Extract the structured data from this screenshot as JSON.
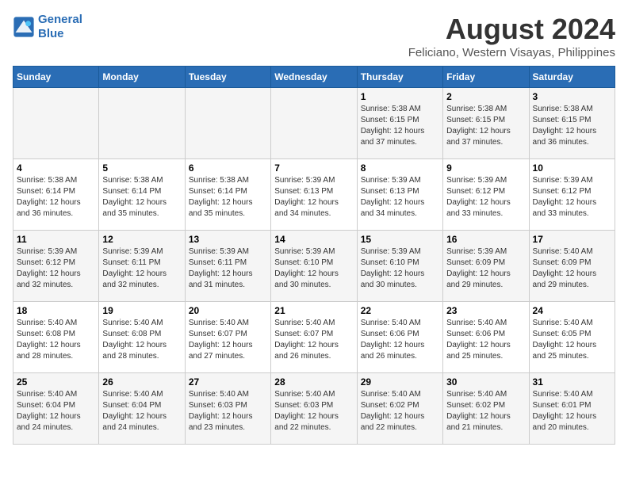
{
  "header": {
    "logo_line1": "General",
    "logo_line2": "Blue",
    "main_title": "August 2024",
    "subtitle": "Feliciano, Western Visayas, Philippines"
  },
  "weekdays": [
    "Sunday",
    "Monday",
    "Tuesday",
    "Wednesday",
    "Thursday",
    "Friday",
    "Saturday"
  ],
  "weeks": [
    [
      {
        "day": "",
        "info": ""
      },
      {
        "day": "",
        "info": ""
      },
      {
        "day": "",
        "info": ""
      },
      {
        "day": "",
        "info": ""
      },
      {
        "day": "1",
        "info": "Sunrise: 5:38 AM\nSunset: 6:15 PM\nDaylight: 12 hours\nand 37 minutes."
      },
      {
        "day": "2",
        "info": "Sunrise: 5:38 AM\nSunset: 6:15 PM\nDaylight: 12 hours\nand 37 minutes."
      },
      {
        "day": "3",
        "info": "Sunrise: 5:38 AM\nSunset: 6:15 PM\nDaylight: 12 hours\nand 36 minutes."
      }
    ],
    [
      {
        "day": "4",
        "info": "Sunrise: 5:38 AM\nSunset: 6:14 PM\nDaylight: 12 hours\nand 36 minutes."
      },
      {
        "day": "5",
        "info": "Sunrise: 5:38 AM\nSunset: 6:14 PM\nDaylight: 12 hours\nand 35 minutes."
      },
      {
        "day": "6",
        "info": "Sunrise: 5:38 AM\nSunset: 6:14 PM\nDaylight: 12 hours\nand 35 minutes."
      },
      {
        "day": "7",
        "info": "Sunrise: 5:39 AM\nSunset: 6:13 PM\nDaylight: 12 hours\nand 34 minutes."
      },
      {
        "day": "8",
        "info": "Sunrise: 5:39 AM\nSunset: 6:13 PM\nDaylight: 12 hours\nand 34 minutes."
      },
      {
        "day": "9",
        "info": "Sunrise: 5:39 AM\nSunset: 6:12 PM\nDaylight: 12 hours\nand 33 minutes."
      },
      {
        "day": "10",
        "info": "Sunrise: 5:39 AM\nSunset: 6:12 PM\nDaylight: 12 hours\nand 33 minutes."
      }
    ],
    [
      {
        "day": "11",
        "info": "Sunrise: 5:39 AM\nSunset: 6:12 PM\nDaylight: 12 hours\nand 32 minutes."
      },
      {
        "day": "12",
        "info": "Sunrise: 5:39 AM\nSunset: 6:11 PM\nDaylight: 12 hours\nand 32 minutes."
      },
      {
        "day": "13",
        "info": "Sunrise: 5:39 AM\nSunset: 6:11 PM\nDaylight: 12 hours\nand 31 minutes."
      },
      {
        "day": "14",
        "info": "Sunrise: 5:39 AM\nSunset: 6:10 PM\nDaylight: 12 hours\nand 30 minutes."
      },
      {
        "day": "15",
        "info": "Sunrise: 5:39 AM\nSunset: 6:10 PM\nDaylight: 12 hours\nand 30 minutes."
      },
      {
        "day": "16",
        "info": "Sunrise: 5:39 AM\nSunset: 6:09 PM\nDaylight: 12 hours\nand 29 minutes."
      },
      {
        "day": "17",
        "info": "Sunrise: 5:40 AM\nSunset: 6:09 PM\nDaylight: 12 hours\nand 29 minutes."
      }
    ],
    [
      {
        "day": "18",
        "info": "Sunrise: 5:40 AM\nSunset: 6:08 PM\nDaylight: 12 hours\nand 28 minutes."
      },
      {
        "day": "19",
        "info": "Sunrise: 5:40 AM\nSunset: 6:08 PM\nDaylight: 12 hours\nand 28 minutes."
      },
      {
        "day": "20",
        "info": "Sunrise: 5:40 AM\nSunset: 6:07 PM\nDaylight: 12 hours\nand 27 minutes."
      },
      {
        "day": "21",
        "info": "Sunrise: 5:40 AM\nSunset: 6:07 PM\nDaylight: 12 hours\nand 26 minutes."
      },
      {
        "day": "22",
        "info": "Sunrise: 5:40 AM\nSunset: 6:06 PM\nDaylight: 12 hours\nand 26 minutes."
      },
      {
        "day": "23",
        "info": "Sunrise: 5:40 AM\nSunset: 6:06 PM\nDaylight: 12 hours\nand 25 minutes."
      },
      {
        "day": "24",
        "info": "Sunrise: 5:40 AM\nSunset: 6:05 PM\nDaylight: 12 hours\nand 25 minutes."
      }
    ],
    [
      {
        "day": "25",
        "info": "Sunrise: 5:40 AM\nSunset: 6:04 PM\nDaylight: 12 hours\nand 24 minutes."
      },
      {
        "day": "26",
        "info": "Sunrise: 5:40 AM\nSunset: 6:04 PM\nDaylight: 12 hours\nand 24 minutes."
      },
      {
        "day": "27",
        "info": "Sunrise: 5:40 AM\nSunset: 6:03 PM\nDaylight: 12 hours\nand 23 minutes."
      },
      {
        "day": "28",
        "info": "Sunrise: 5:40 AM\nSunset: 6:03 PM\nDaylight: 12 hours\nand 22 minutes."
      },
      {
        "day": "29",
        "info": "Sunrise: 5:40 AM\nSunset: 6:02 PM\nDaylight: 12 hours\nand 22 minutes."
      },
      {
        "day": "30",
        "info": "Sunrise: 5:40 AM\nSunset: 6:02 PM\nDaylight: 12 hours\nand 21 minutes."
      },
      {
        "day": "31",
        "info": "Sunrise: 5:40 AM\nSunset: 6:01 PM\nDaylight: 12 hours\nand 20 minutes."
      }
    ]
  ]
}
